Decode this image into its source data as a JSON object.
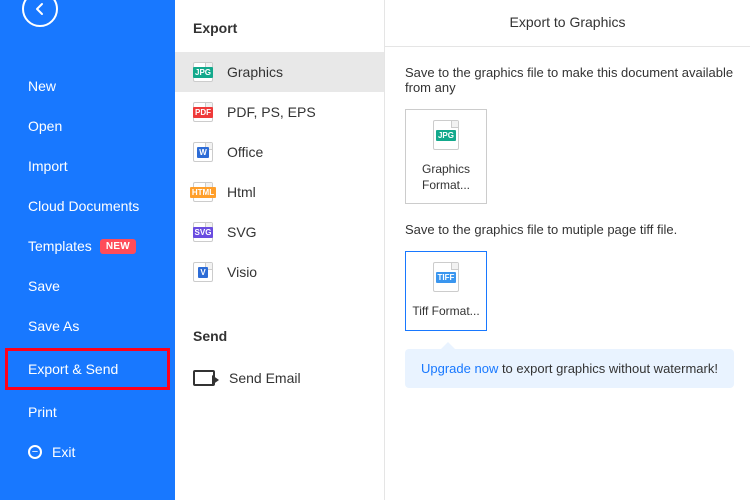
{
  "sidebar": {
    "items": [
      {
        "label": "New"
      },
      {
        "label": "Open"
      },
      {
        "label": "Import"
      },
      {
        "label": "Cloud Documents"
      },
      {
        "label": "Templates",
        "badge": "NEW"
      },
      {
        "label": "Save"
      },
      {
        "label": "Save As"
      },
      {
        "label": "Export & Send"
      },
      {
        "label": "Print"
      },
      {
        "label": "Exit"
      }
    ]
  },
  "middle": {
    "exportHeader": "Export",
    "sendHeader": "Send",
    "exportItems": [
      {
        "label": "Graphics",
        "tag": "JPG"
      },
      {
        "label": "PDF, PS, EPS",
        "tag": "PDF"
      },
      {
        "label": "Office",
        "tag": "W"
      },
      {
        "label": "Html",
        "tag": "HTML"
      },
      {
        "label": "SVG",
        "tag": "SVG"
      },
      {
        "label": "Visio",
        "tag": "V"
      }
    ],
    "sendItems": [
      {
        "label": "Send Email"
      }
    ]
  },
  "main": {
    "title": "Export to Graphics",
    "desc1": "Save to the graphics file to make this document available from any",
    "tile1": {
      "label": "Graphics Format...",
      "tag": "JPG"
    },
    "desc2": "Save to the graphics file to mutiple page tiff file.",
    "tile2": {
      "label": "Tiff Format...",
      "tag": "TIFF"
    },
    "upgrade": {
      "link": "Upgrade now",
      "rest": " to export graphics without watermark!"
    }
  }
}
